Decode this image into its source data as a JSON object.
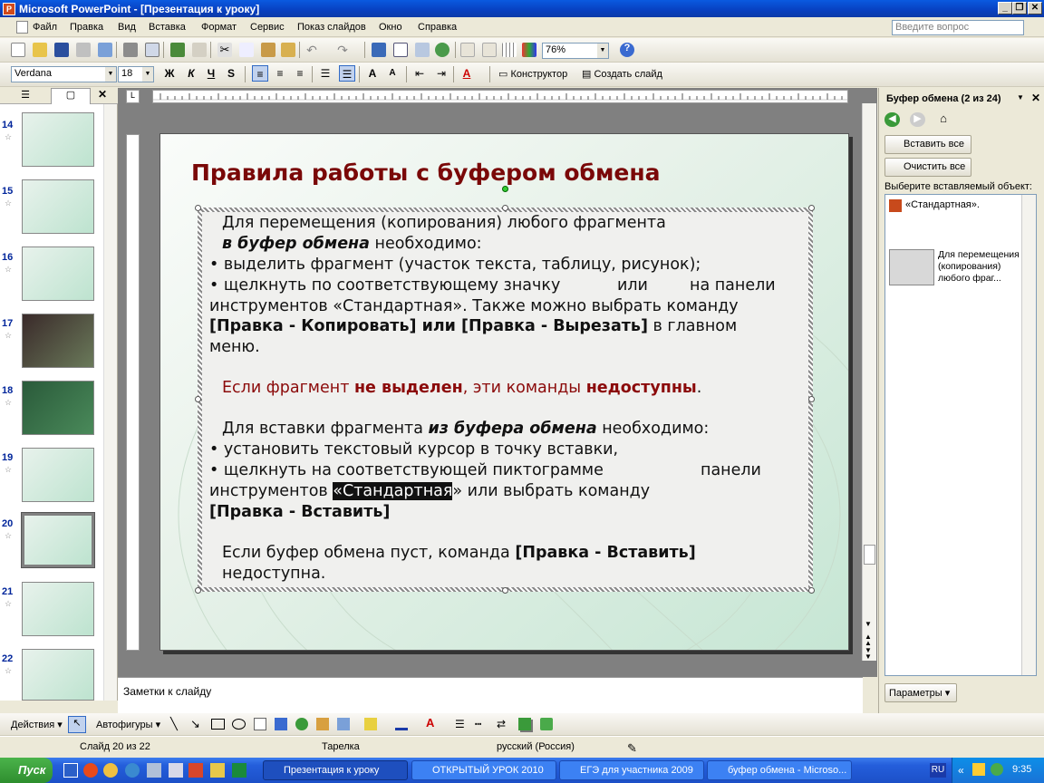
{
  "window": {
    "title": "Microsoft PowerPoint - [Презентация к уроку]"
  },
  "menu": {
    "items": [
      "Файл",
      "Правка",
      "Вид",
      "Вставка",
      "Формат",
      "Сервис",
      "Показ слайдов",
      "Окно",
      "Справка"
    ],
    "help_placeholder": "Введите вопрос"
  },
  "toolbar": {
    "zoom": "76%",
    "font": "Verdana",
    "size": "18",
    "bold": "Ж",
    "italic": "К",
    "underline": "Ч",
    "shadow": "S",
    "designer": "Конструктор",
    "new_slide": "Создать слайд"
  },
  "thumbnails": [
    {
      "num": "14"
    },
    {
      "num": "15"
    },
    {
      "num": "16"
    },
    {
      "num": "17"
    },
    {
      "num": "18"
    },
    {
      "num": "19"
    },
    {
      "num": "20"
    },
    {
      "num": "21"
    },
    {
      "num": "22"
    }
  ],
  "slide": {
    "title": "Правила работы с буфером обмена",
    "l1": "Для перемещения (копирования) любого фрагмента",
    "l2a": "в буфер обмена",
    "l2b": " необходимо:",
    "l3": "•  выделить фрагмент (участок текста, таблицу, рисунок);",
    "l4a": "•  щелкнуть по соответствующему значку",
    "l4b": "или",
    "l4c": "на панели",
    "l5": "инструментов  «Стандартная». Также можно  выбрать команду",
    "l6a": "[Правка - Копировать] или [Правка - Вырезать]",
    "l6b": " в главном",
    "l7": "меню.",
    "l8a": "Если фрагмент ",
    "l8b": "не выделен",
    "l8c": ", эти команды ",
    "l8d": "недоступны",
    "l8e": ".",
    "l9a": "Для вставки фрагмента ",
    "l9b": "из буфера обмена",
    "l9c": " необходимо:",
    "l10": "•  установить текстовый курсор в точку вставки,",
    "l11a": "•  щелкнуть на соответствующей пиктограмме",
    "l11b": "панели",
    "l12a": "инструментов ",
    "l12b": "«Стандартная",
    "l12c": "» или выбрать команду",
    "l13": "[Правка - Вставить]",
    "l14a": "Если буфер обмена пуст, команда ",
    "l14b": "[Правка - Вставить]",
    "l15": "недоступна."
  },
  "notes": {
    "placeholder": "Заметки к слайду"
  },
  "taskpane": {
    "title": "Буфер обмена (2 из 24)",
    "paste_all": "Вставить все",
    "clear_all": "Очистить все",
    "select_label": "Выберите вставляемый объект:",
    "item1": "«Стандартная».",
    "item2": "Для перемещения (копирования) любого фраг...",
    "options": "Параметры"
  },
  "drawbar": {
    "actions": "Действия",
    "autoshapes": "Автофигуры"
  },
  "status": {
    "slide": "Слайд 20 из 22",
    "design": "Тарелка",
    "lang": "русский (Россия)"
  },
  "taskbar": {
    "start": "Пуск",
    "tasks": [
      "Презентация к уроку",
      "ОТКРЫТЫЙ УРОК 2010",
      "ЕГЭ для участника 2009",
      "буфер обмена - Microso..."
    ],
    "lang": "RU",
    "clock": "9:35"
  },
  "colors": {
    "title_red": "#7a0808",
    "accent_red": "#8b0a0a",
    "xp_blue": "#245edb"
  }
}
